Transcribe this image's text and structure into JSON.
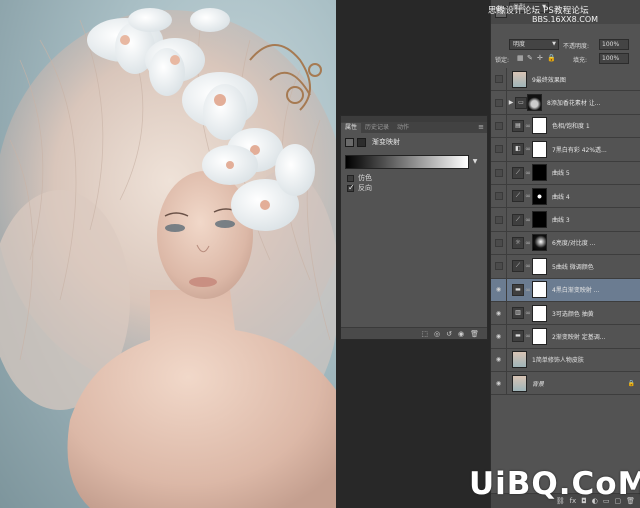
{
  "watermark": {
    "top_line1": "思缘设计论坛  PS教程论坛",
    "top_line2": "BBS.16XX8.COM",
    "logo_text": "UiBQ.CoM"
  },
  "properties_panel": {
    "tabs": [
      "属性",
      "历史记录",
      "动作"
    ],
    "active_tab": "属性",
    "title": "渐变映射",
    "checkbox_dither": {
      "label": "仿色",
      "checked": false
    },
    "checkbox_reverse": {
      "label": "反向",
      "checked": true
    }
  },
  "layers_panel": {
    "kind_filter": "类型",
    "blend_mode": "明度",
    "opacity_label": "不透明度:",
    "opacity_value": "100%",
    "lock_label": "锁定:",
    "fill_label": "填充:",
    "fill_value": "100%",
    "layers": [
      {
        "name": "9最终效果图",
        "visible": false,
        "thumb": "portrait",
        "icon": "",
        "selected": false,
        "italic": false,
        "folder": false
      },
      {
        "name": "8添加香花素材 让...",
        "visible": false,
        "thumb": "fold",
        "icon": "folder-icon",
        "selected": false,
        "italic": false,
        "folder": true
      },
      {
        "name": "色相/饱和度 1",
        "visible": false,
        "thumb": "white",
        "icon": "hue-icon",
        "selected": false,
        "italic": false,
        "folder": false
      },
      {
        "name": "7黑白有彩 42%透...",
        "visible": false,
        "thumb": "white",
        "icon": "bw-icon",
        "selected": false,
        "italic": false,
        "folder": false
      },
      {
        "name": "曲线 5",
        "visible": false,
        "thumb": "black",
        "icon": "curves-icon",
        "selected": false,
        "italic": false,
        "folder": false
      },
      {
        "name": "曲线 4",
        "visible": false,
        "thumb": "dot",
        "icon": "curves-icon",
        "selected": false,
        "italic": false,
        "folder": false
      },
      {
        "name": "曲线 3",
        "visible": false,
        "thumb": "black",
        "icon": "curves-icon",
        "selected": false,
        "italic": false,
        "folder": false
      },
      {
        "name": "6亮度/对比度 ...",
        "visible": false,
        "thumb": "gradient",
        "icon": "brightness-icon",
        "selected": false,
        "italic": false,
        "folder": false
      },
      {
        "name": "5曲线 微调颜色",
        "visible": false,
        "thumb": "white",
        "icon": "curves-icon",
        "selected": false,
        "italic": false,
        "folder": false
      },
      {
        "name": "4黑白渐变映射 ...",
        "visible": true,
        "thumb": "white",
        "icon": "gradient-map-icon",
        "selected": true,
        "italic": false,
        "folder": false
      },
      {
        "name": "3可选颜色 抽黄",
        "visible": true,
        "thumb": "white",
        "icon": "selective-color-icon",
        "selected": false,
        "italic": false,
        "folder": false
      },
      {
        "name": "2渐变映射 定基调...",
        "visible": true,
        "thumb": "white",
        "icon": "gradient-map-icon",
        "selected": false,
        "italic": false,
        "folder": false
      },
      {
        "name": "1简单修饰人物皮肤",
        "visible": true,
        "thumb": "portrait",
        "icon": "",
        "selected": false,
        "italic": false,
        "folder": false
      },
      {
        "name": "背景",
        "visible": true,
        "thumb": "portrait",
        "icon": "",
        "selected": false,
        "italic": true,
        "folder": false
      }
    ]
  }
}
